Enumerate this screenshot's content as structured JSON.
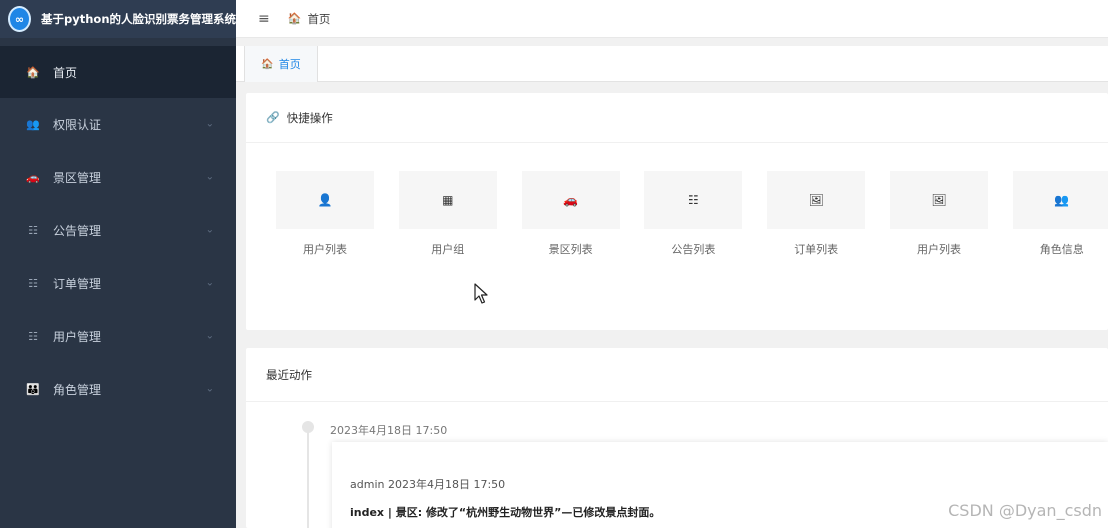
{
  "brand": {
    "logo_text": "∞",
    "title": "基于python的人脸识别票务管理系统"
  },
  "topbar": {
    "menu_icon": "≡",
    "home_icon": "🏠",
    "home_label": "首页"
  },
  "sidebar": {
    "items": [
      {
        "icon": "home-icon",
        "glyph": "🏠",
        "label": "首页",
        "active": true
      },
      {
        "icon": "users-key-icon",
        "glyph": "👥",
        "label": "权限认证",
        "chev": "⌄"
      },
      {
        "icon": "car-icon",
        "glyph": "🚗",
        "label": "景区管理",
        "chev": "⌄"
      },
      {
        "icon": "list-icon",
        "glyph": "☷",
        "label": "公告管理",
        "chev": "⌄"
      },
      {
        "icon": "list-icon",
        "glyph": "☷",
        "label": "订单管理",
        "chev": "⌄"
      },
      {
        "icon": "list-icon",
        "glyph": "☷",
        "label": "用户管理",
        "chev": "⌄"
      },
      {
        "icon": "group-icon",
        "glyph": "👪",
        "label": "角色管理",
        "chev": "⌄"
      }
    ]
  },
  "tabs": [
    {
      "glyph": "🏠",
      "label": "首页"
    }
  ],
  "quick": {
    "title": "快捷操作",
    "link_glyph": "🔗",
    "items": [
      {
        "icon": "user-icon",
        "glyph": "👤",
        "label": "用户列表"
      },
      {
        "icon": "table-icon",
        "glyph": "▦",
        "label": "用户组"
      },
      {
        "icon": "car-icon",
        "glyph": "🚗",
        "label": "景区列表"
      },
      {
        "icon": "list-icon",
        "glyph": "☷",
        "label": "公告列表"
      },
      {
        "icon": "image-icon",
        "glyph": "🖼",
        "label": "订单列表"
      },
      {
        "icon": "image-icon",
        "glyph": "🖼",
        "label": "用户列表"
      },
      {
        "icon": "group-icon",
        "glyph": "👥",
        "label": "角色信息"
      }
    ]
  },
  "recent": {
    "title": "最近动作",
    "entries": [
      {
        "date": "2023年4月18日 17:50",
        "head": "admin 2023年4月18日 17:50",
        "action": "index | 景区: ",
        "detail": "修改了“杭州野生动物世界”—已修改景点封面。"
      }
    ]
  },
  "watermark": "CSDN @Dyan_csdn"
}
